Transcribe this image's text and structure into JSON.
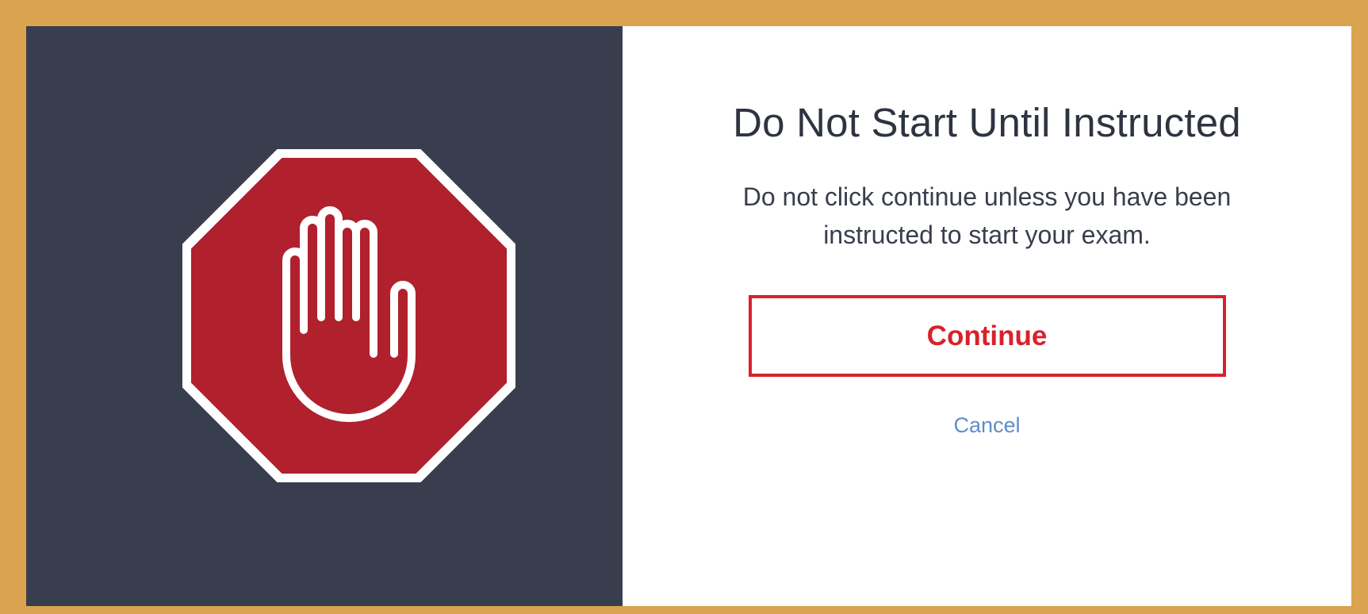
{
  "dialog": {
    "title": "Do Not Start Until Instructed",
    "message": "Do not click continue unless you have been instructed to start your exam.",
    "continue_label": "Continue",
    "cancel_label": "Cancel"
  },
  "icons": {
    "stop_sign": "stop-hand-octagon-icon"
  },
  "colors": {
    "frame": "#D9A34F",
    "left_panel": "#383E4D",
    "stop_red": "#B0202D",
    "accent_red": "#D8222A",
    "cancel_blue": "#5E8ECB",
    "title_text": "#2F3441"
  }
}
